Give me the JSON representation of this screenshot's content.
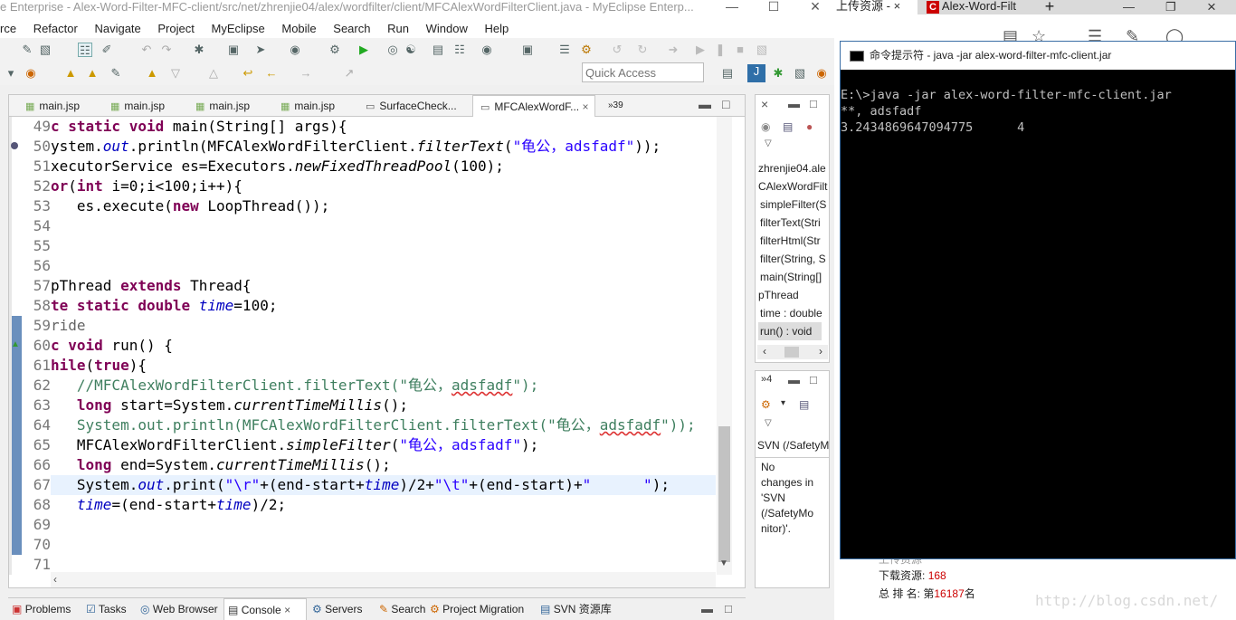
{
  "eclipse": {
    "title": "e Enterprise - Alex-Word-Filter-MFC-client/src/net/zhrenjie04/alex/wordfilter/client/MFCAlexWordFilterClient.java - MyEclipse Enterp...",
    "menu": [
      "rce",
      "Refactor",
      "Navigate",
      "Project",
      "MyEclipse",
      "Mobile",
      "Search",
      "Run",
      "Window",
      "Help"
    ],
    "quick_access_placeholder": "Quick Access",
    "editor_tabs": [
      "main.jsp",
      "main.jsp",
      "main.jsp",
      "main.jsp",
      "SurfaceCheck...",
      "MFCAlexWordF..."
    ],
    "editor_tab_overflow": "»39",
    "line_numbers": [
      "49",
      "50",
      "51",
      "52",
      "53",
      "54",
      "55",
      "56",
      "57",
      "58",
      "59",
      "60",
      "61",
      "62",
      "63",
      "64",
      "65",
      "66",
      "67",
      "68",
      "69",
      "70",
      "71"
    ],
    "outline": {
      "items": [
        "zhrenjie04.ale",
        "CAlexWordFilt",
        "simpleFilter(S",
        "filterText(Stri",
        "filterHtml(Str",
        "filter(String, S",
        "main(String[]",
        "pThread",
        "time : double",
        "run() : void"
      ],
      "view_overflow": "»4"
    },
    "svn_panel": {
      "title": "SVN (/SafetyM",
      "message_lines": [
        "No",
        "changes in",
        "'SVN",
        "(/SafetyMo",
        "nitor)'."
      ]
    },
    "bottom_tabs": [
      "Problems",
      "Tasks",
      "Web Browser",
      "Console",
      "Servers",
      "Search",
      "Project Migration",
      "SVN 资源库"
    ]
  },
  "browser": {
    "tab1": "上传资源 -",
    "tab2": "Alex-Word-Filt",
    "new_tab": "+",
    "stats": {
      "downloads_label": "下载资源:",
      "downloads_value": "168",
      "rank_label": "总 排 名:",
      "rank_prefix": "第",
      "rank_value": "16187",
      "rank_suffix": "名"
    },
    "watermark": "http://blog.csdn.net/"
  },
  "cmd": {
    "title": "命令提示符 - java  -jar alex-word-filter-mfc-client.jar",
    "lines": [
      "E:\\>java -jar alex-word-filter-mfc-client.jar",
      "**, adsfadf",
      "3.2434869647094775      4"
    ]
  }
}
